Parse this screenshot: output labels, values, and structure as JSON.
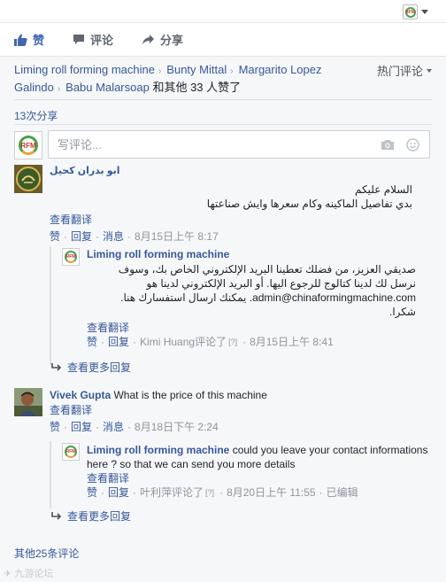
{
  "colors": {
    "link": "#365899",
    "like_blue": "#4267b2",
    "panel_bg": "#f6f7f9",
    "meta": "#90949c"
  },
  "actions": {
    "like": "赞",
    "comment": "评论",
    "share": "分享"
  },
  "likers": {
    "names": [
      "Liming roll forming machine",
      "Bunty Mittal",
      "Margarito Lopez Galindo",
      "Babu Malarsoap"
    ],
    "suffix": "和其他 33 人赞了"
  },
  "sort_menu": {
    "label": "热门评论"
  },
  "shares": {
    "label": "13次分享"
  },
  "composer": {
    "placeholder": "写评论..."
  },
  "comments": [
    {
      "author": "ابو بدران كحيل",
      "text_lines": [
        "السلام عليكم",
        "بدي تفاصيل الماكينه وكام سعرها وايش صناعتها"
      ],
      "translate": "查看翻译",
      "like": "赞",
      "reply": "回复",
      "message": "消息",
      "time": "8月15日上午 8:17",
      "reply_item": {
        "author": "Liming roll forming machine",
        "text_lines": [
          "صديقي العزيز، من فضلك تعطينا البريد الإلكتروني الخاص بك، وسوف",
          "نرسل لك لدينا كتالوج للرجوع اليها. أو البريد الإلكتروني لدينا هو",
          "admin@chinaformingmachine.com. يمكنك ارسال استفسارك هنا.",
          "شكرا."
        ],
        "translate": "查看翻译",
        "like": "赞",
        "reply": "回复",
        "replied_by": "Kimi Huang评论了",
        "badge": "[?]",
        "time": "8月15日上午 8:41"
      },
      "more_replies": "查看更多回复"
    },
    {
      "author": "Vivek Gupta",
      "text": "What is the price of this machine",
      "translate": "查看翻译",
      "like": "赞",
      "reply": "回复",
      "message": "消息",
      "time": "8月18日下午 2:24",
      "reply_item": {
        "author": "Liming roll forming machine",
        "text": "could you leave your contact informations here ? so that we can send you more details",
        "translate": "查看翻译",
        "like": "赞",
        "reply": "回复",
        "replied_by": "叶利萍评论了",
        "badge": "[?]",
        "time": "8月20日上午 11:55",
        "edited": "已编辑"
      },
      "more_replies": "查看更多回复"
    }
  ],
  "more_comments": "其他25条评论",
  "watermark": "九游论坛",
  "icons": {
    "like": "thumbs-up-icon",
    "comment": "speech-bubble-icon",
    "share": "share-arrow-icon",
    "camera": "camera-icon",
    "emoji": "smiley-icon",
    "reply_arrow": "reply-arrow-icon"
  }
}
